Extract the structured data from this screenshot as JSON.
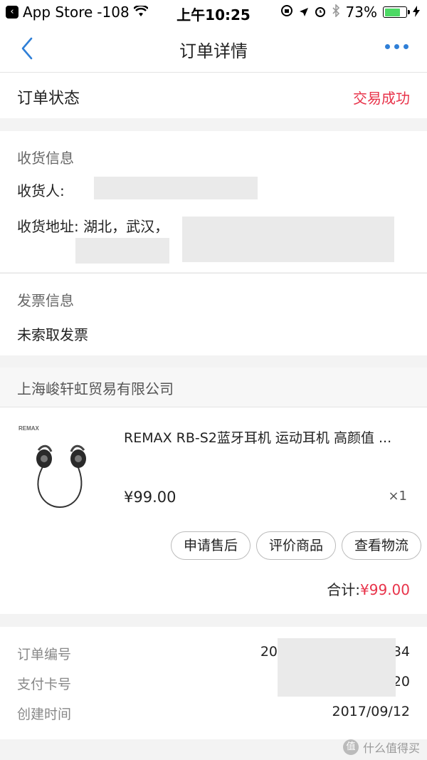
{
  "status_bar": {
    "back_app": "App Store",
    "signal": "-108",
    "time": "上午10:25",
    "battery": "73%",
    "battery_level": 0.73,
    "battery_color": "#4cd964"
  },
  "nav": {
    "title": "订单详情",
    "back_icon": "chevron-left-icon",
    "more_icon": "more-dots-icon",
    "accent": "#2f7fd7"
  },
  "order_status": {
    "label": "订单状态",
    "value": "交易成功",
    "value_color": "#e8334a"
  },
  "shipping": {
    "title": "收货信息",
    "recipient_label": "收货人:",
    "address_label": "收货地址:",
    "address_value": "湖北，武汉，"
  },
  "invoice": {
    "title": "发票信息",
    "value": "未索取发票"
  },
  "shop": {
    "name": "上海峻轩虹贸易有限公司"
  },
  "product": {
    "brand_text": "REMAX",
    "title": "REMAX RB-S2蓝牙耳机 运动耳机 高颜值 ...",
    "price": "¥99.00",
    "qty": "×1",
    "buttons": [
      "申请售后",
      "评价商品",
      "查看物流"
    ],
    "total_label": "合计:",
    "total_value": "¥99.00"
  },
  "order_info": {
    "order_no_label": "订单编号",
    "order_no_prefix": "20",
    "order_no_suffix": "34",
    "card_label": "支付卡号",
    "card_suffix": "20",
    "created_label": "创建时间",
    "created_value": "2017/09/12"
  },
  "watermark": {
    "text": "什么值得买",
    "badge": "值"
  }
}
